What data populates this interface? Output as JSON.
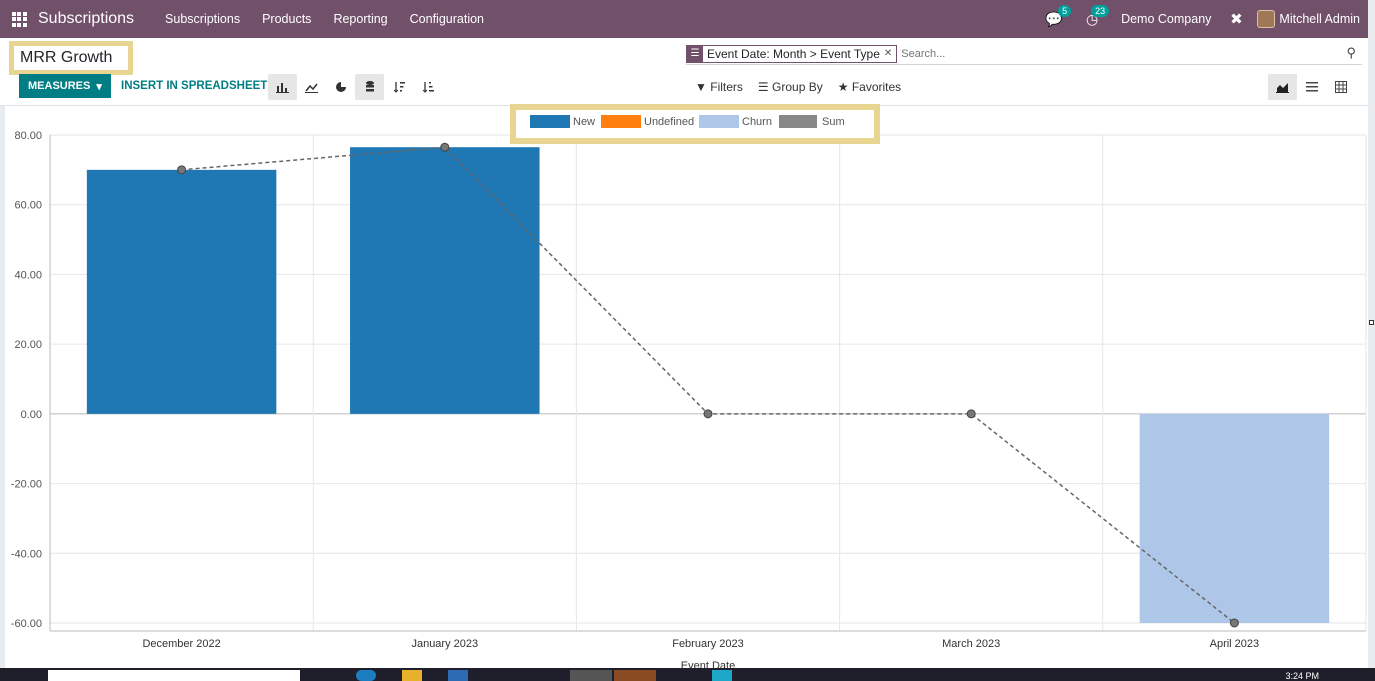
{
  "navbar": {
    "brand": "Subscriptions",
    "menu": [
      "Subscriptions",
      "Products",
      "Reporting",
      "Configuration"
    ],
    "chat_count": "5",
    "activity_count": "23",
    "company": "Demo Company",
    "user": "Mitchell Admin",
    "accent_color": "#71506a"
  },
  "control": {
    "title": "MRR Growth",
    "facet": "Event Date: Month > Event Type",
    "search_placeholder": "Search...",
    "measures_label": "MEASURES",
    "insert_label": "INSERT IN SPREADSHEET",
    "filters_label": "Filters",
    "groupby_label": "Group By",
    "favorites_label": "Favorites"
  },
  "chart_data": {
    "type": "bar",
    "categories": [
      "December 2022",
      "January 2023",
      "February 2023",
      "March 2023",
      "April 2023"
    ],
    "series": [
      {
        "name": "New",
        "values": [
          70,
          76.5,
          0,
          0,
          0
        ],
        "color": "#1f77b4"
      },
      {
        "name": "Undefined",
        "values": [
          0,
          0,
          0,
          0,
          0
        ],
        "color": "#ff7f0e"
      },
      {
        "name": "Churn",
        "values": [
          0,
          0,
          0,
          0,
          -60
        ],
        "color": "#aec7e8"
      },
      {
        "name": "Sum",
        "type": "line",
        "values": [
          70,
          76.5,
          0,
          0,
          -60
        ],
        "color": "#555555"
      }
    ],
    "xlabel": "Event Date",
    "ylabel": "",
    "ylim": [
      -60,
      80
    ],
    "yticks": [
      "80.00",
      "60.00",
      "40.00",
      "20.00",
      "0.00",
      "-20.00",
      "-40.00",
      "-60.00"
    ],
    "ytick_values": [
      80,
      60,
      40,
      20,
      0,
      -20,
      -40,
      -60
    ],
    "grid": true,
    "legend": "top-center"
  },
  "taskbar": {
    "clock": "3:24 PM"
  }
}
